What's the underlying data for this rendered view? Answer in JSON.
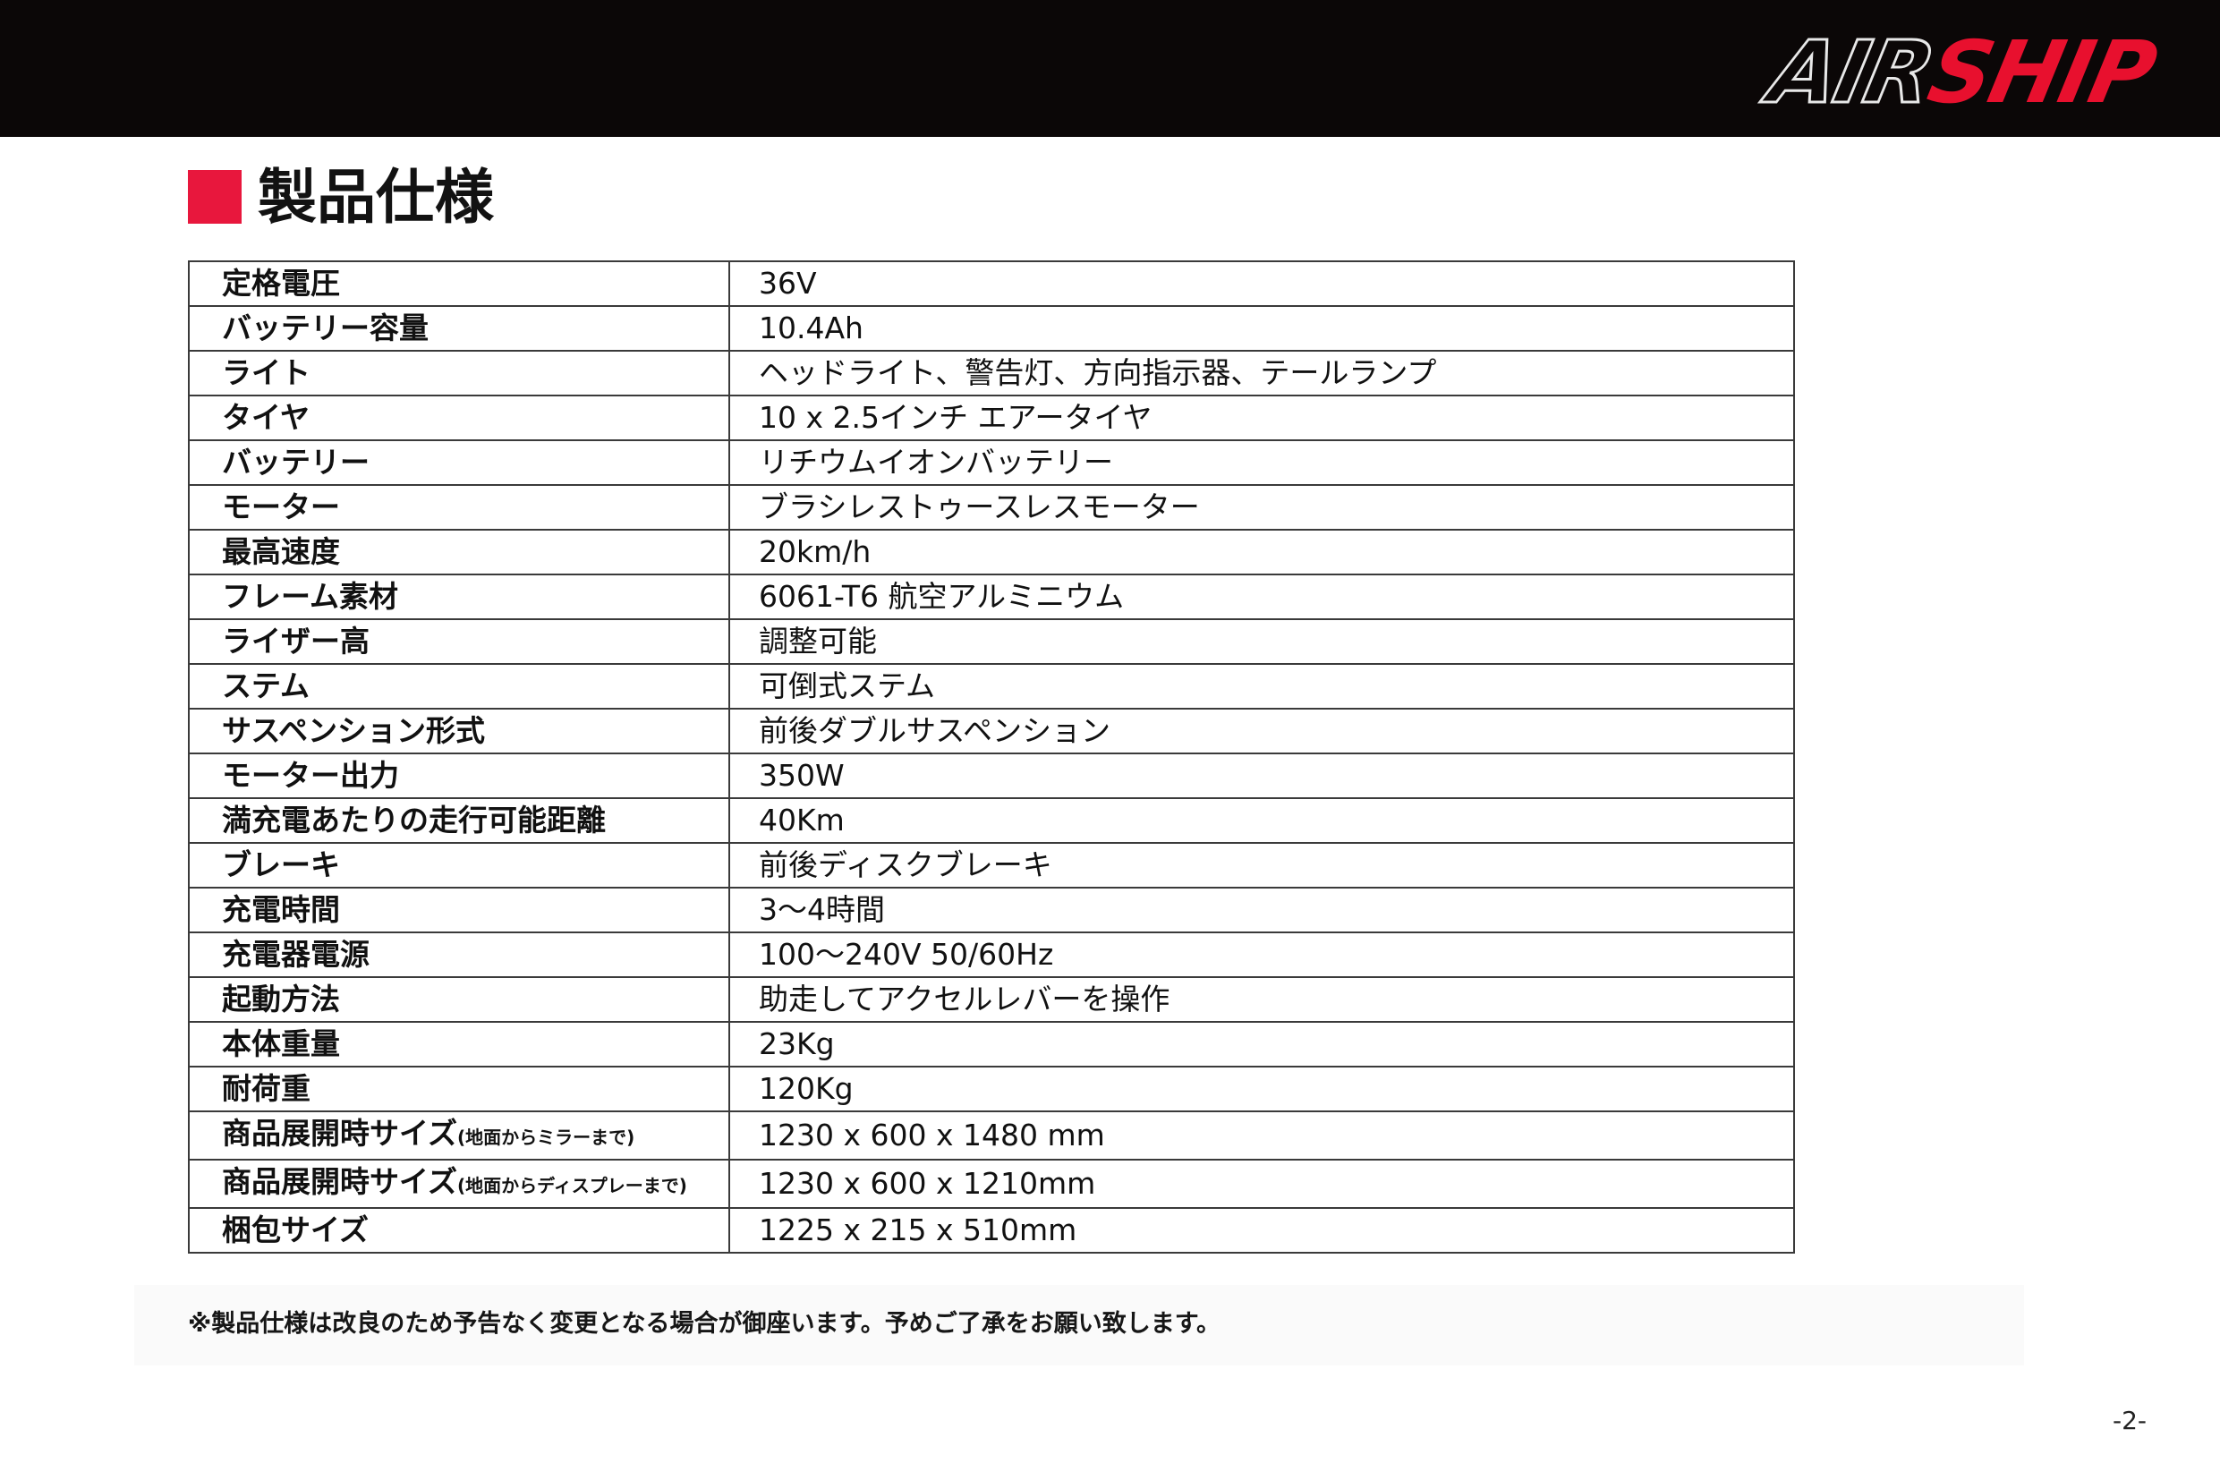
{
  "brand": {
    "logo_part1": "AIR",
    "logo_part2": "SHIP",
    "logo_colors": {
      "part1": "#0b0707",
      "part1_outline": "#e8e8e8",
      "part2": "#e8102e"
    }
  },
  "section": {
    "title": "製品仕様",
    "marker_color": "#e8173d"
  },
  "specs": [
    {
      "label": "定格電圧",
      "value": "36V"
    },
    {
      "label": "バッテリー容量",
      "value": "10.4Ah"
    },
    {
      "label": "ライト",
      "value": "ヘッドライト、警告灯、方向指示器、テールランプ"
    },
    {
      "label": "タイヤ",
      "value": "10 x 2.5インチ エアータイヤ"
    },
    {
      "label": "バッテリー",
      "value": "リチウムイオンバッテリー"
    },
    {
      "label": "モーター",
      "value": "ブラシレストゥースレスモーター"
    },
    {
      "label": "最高速度",
      "value": "20km/h"
    },
    {
      "label": "フレーム素材",
      "value": "6061-T6 航空アルミニウム"
    },
    {
      "label": "ライザー高",
      "value": "調整可能"
    },
    {
      "label": "ステム",
      "value": "可倒式ステム"
    },
    {
      "label": "サスペンション形式",
      "value": "前後ダブルサスペンション"
    },
    {
      "label": "モーター出力",
      "value": "350W"
    },
    {
      "label": "満充電あたりの走行可能距離",
      "value": "40Km"
    },
    {
      "label": "ブレーキ",
      "value": "前後ディスクブレーキ"
    },
    {
      "label": "充電時間",
      "value": "3〜4時間"
    },
    {
      "label": "充電器電源",
      "value": "100〜240V 50/60Hz"
    },
    {
      "label": "起動方法",
      "value": "助走してアクセルレバーを操作"
    },
    {
      "label": "本体重量",
      "value": "23Kg"
    },
    {
      "label": "耐荷重",
      "value": "120Kg"
    },
    {
      "label": "商品展開時サイズ",
      "label_note": "(地面からミラーまで)",
      "value": "1230 x 600 x 1480 mm"
    },
    {
      "label": "商品展開時サイズ",
      "label_note": "(地面からディスプレーまで)",
      "value": "1230 x 600 x 1210mm"
    },
    {
      "label": "梱包サイズ",
      "value": "1225 x 215 x 510mm"
    }
  ],
  "footnote": "※製品仕様は改良のため予告なく変更となる場合が御座います。予めご了承をお願い致します。",
  "page_number": "-2-"
}
